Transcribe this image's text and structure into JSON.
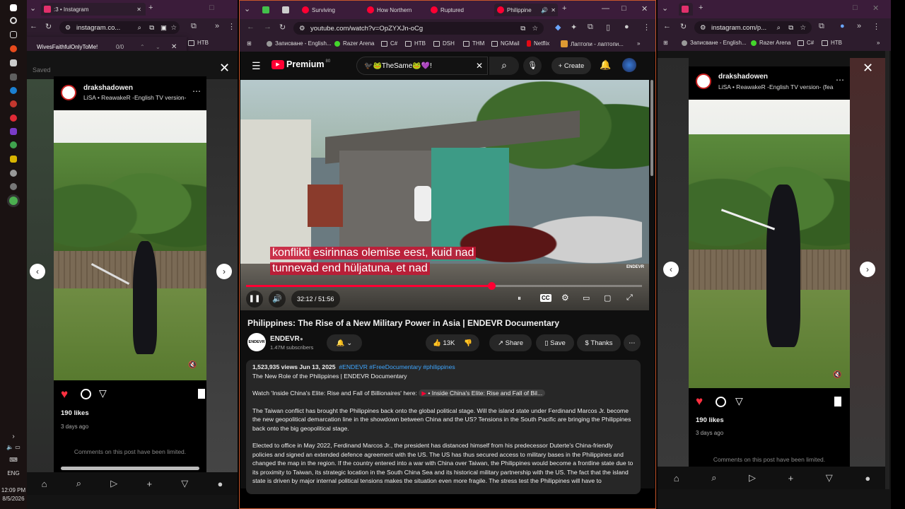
{
  "taskbar": {
    "time": "12:09 PM",
    "date": "8/5/2026",
    "lang": "ENG"
  },
  "left_browser": {
    "tab_title": ":3 • Instagram",
    "url": "instagram.co...",
    "bookmark": "НТВ",
    "find": {
      "query": "WivesFaithfulOnlyToMe!",
      "count": "0/0"
    },
    "saved_label": "Saved",
    "post": {
      "username": "drakshadowen",
      "song": "LiSA • ReawakeR -English TV version-",
      "likes": "190 likes",
      "time_ago": "3 days ago",
      "comments_note": "Comments on this post have been limited."
    }
  },
  "youtube_window": {
    "tabs": [
      "Surviving",
      "How Northern",
      "Ruptured",
      "Philippine"
    ],
    "url": "youtube.com/watch?v=OpZYXJn-oCg",
    "bookmarks": [
      "Записване - English...",
      "Razer Arena",
      "C#",
      "НТВ",
      "DSH",
      "ТНМ",
      "NGMail",
      "Netflix",
      "Лаптопи - лаптопи..."
    ],
    "logo_text": "Premium",
    "logo_sup": "80",
    "search_value": "🐦‍⬛🐸TheSame🐸💜!",
    "create_label": "+ Create",
    "subtitle_lines": [
      "konflikti esirinnas olemise eest, kuid nad",
      "tunnevad end hüljatuna, et nad"
    ],
    "watermark": "ENDEVR",
    "time_display": "32:12 / 51:56",
    "progress": 0.62,
    "title": "Philippines: The Rise of a New Military Power in Asia | ENDEVR Documentary",
    "channel": {
      "name": "ENDEVR",
      "subscribers": "1.47M subscribers",
      "avatar_text": "ENDEVR"
    },
    "actions": {
      "likes": "13K",
      "share": "Share",
      "save": "Save",
      "thanks": "Thanks"
    },
    "description": {
      "stats": "1,523,935 views  Jun 13, 2025",
      "hashtags": "#ENDEVR #FreeDocumentary #philippines",
      "subtitle": "The New Role of the Philippines | ENDEVR Documentary",
      "watch_prefix": "Watch 'Inside China's Elite: Rise and Fall of Billionaires' here:",
      "watch_link": "• Inside China's Elite: Rise and Fall of Bil...",
      "para1": "The Taiwan conflict has brought the Philippines back onto the global political stage. Will the island state under Ferdinand Marcos Jr. become the new geopolitical demarcation line in the showdown between China and the US? Tensions in the South Pacific are bringing the Philippines back onto the big geopolitical stage.",
      "para2": "Elected to office in May 2022, Ferdinand Marcos Jr., the president has distanced himself from his predecessor Duterte's China-friendly policies and signed an extended defence agreement with the US. The US has thus secured access to military bases in the Philippines and changed the map in the region. If the country entered into a war with China over Taiwan, the Philippines would become a frontline state due to its proximity to Taiwan, its strategic location in the South China Sea and its historical military partnership with the US. The fact that the island state is driven by major internal political tensions makes the situation even more fragile. The stress test the Philippines will have to"
    }
  },
  "right_browser": {
    "url": "instagram.com/p...",
    "bookmarks": [
      "Записване - English...",
      "Razer Arena",
      "C#",
      "НТВ"
    ],
    "post": {
      "username": "drakshadowen",
      "song": "LiSA • ReawakeR -English TV version- (fea",
      "likes": "190 likes",
      "time_ago": "3 days ago",
      "comments_note": "Comments on this post have been limited."
    }
  },
  "colors": {
    "accent_red": "#ff0033",
    "window_purple": "#3b1c3a",
    "yt_bg": "#0f0f0f"
  }
}
